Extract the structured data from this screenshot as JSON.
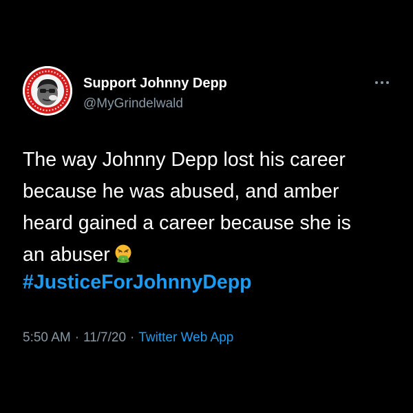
{
  "colors": {
    "background": "#000000",
    "text": "#ffffff",
    "muted": "#8899a6",
    "accent": "#1d9bf0"
  },
  "author": {
    "display_name": "Support Johnny Depp",
    "handle": "@MyGrindelwald",
    "avatar_icon": "profile-avatar-red-ring"
  },
  "more_icon": "more-dots-icon",
  "tweet": {
    "lines": [
      "The way Johnny Depp lost his career",
      "because he was abused, and amber",
      "heard gained a career because she is",
      "an abuser"
    ],
    "emoji": "vomiting-face-emoji",
    "hashtag": "#JusticeForJohnnyDepp"
  },
  "meta": {
    "time": "5:50 AM",
    "separator": "·",
    "date": "11/7/20",
    "source": "Twitter Web App"
  }
}
